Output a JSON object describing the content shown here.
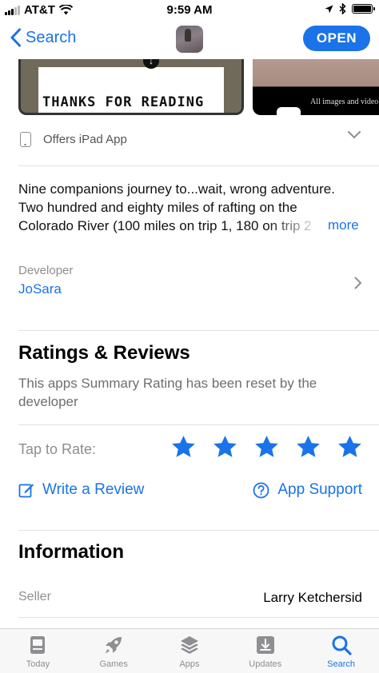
{
  "status_bar": {
    "carrier": "AT&T",
    "time": "9:59 AM",
    "wifi_icon": "wifi-icon",
    "location_icon": "location-arrow-icon",
    "bluetooth_icon": "bluetooth-icon",
    "battery_icon": "battery-icon"
  },
  "nav": {
    "back_label": "Search",
    "open_label": "OPEN"
  },
  "screenshots": {
    "shot1_text": "THANKS FOR READING",
    "shot2_caption": "All images and video"
  },
  "ipad": {
    "label": "Offers iPad App"
  },
  "description": {
    "lines": [
      "Nine companions journey to...wait, wrong adventure.",
      "Two hundred and eighty miles of rafting on the",
      "Colorado River (100 miles on trip 1, 180 on trip 2"
    ],
    "more_label": "more"
  },
  "developer": {
    "label": "Developer",
    "name": "JoSara"
  },
  "ratings": {
    "title": "Ratings & Reviews",
    "reset_text": "This apps Summary Rating has been reset by the developer",
    "tap_to_rate": "Tap to Rate:",
    "star_count": 5,
    "write_review": "Write a Review",
    "app_support": "App Support"
  },
  "information": {
    "title": "Information",
    "rows": [
      {
        "label": "Seller",
        "value": "Larry Ketchersid"
      }
    ]
  },
  "tab_bar": {
    "tabs": [
      {
        "label": "Today",
        "icon": "today-icon"
      },
      {
        "label": "Games",
        "icon": "rocket-icon"
      },
      {
        "label": "Apps",
        "icon": "layers-icon"
      },
      {
        "label": "Updates",
        "icon": "download-tray-icon"
      },
      {
        "label": "Search",
        "icon": "search-icon"
      }
    ],
    "active": "Search"
  },
  "colors": {
    "accent": "#1a73e8",
    "secondary_text": "#8e8e93"
  }
}
